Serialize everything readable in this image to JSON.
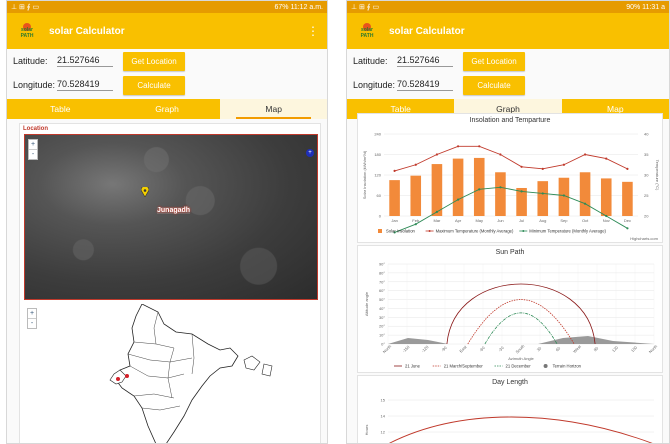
{
  "left_screen": {
    "status": {
      "left_icons": "⊥ ⊞ ∮ ▭",
      "right": "67% 11:12 a.m."
    },
    "app_title": "solar Calculator",
    "logo_text": "solar PATH",
    "menu_icon": "⋮",
    "latitude_label": "Latitude:",
    "latitude_value": "21.527646",
    "longitude_label": "Longitude:",
    "longitude_value": "70.528419",
    "get_location_label": "Get Location",
    "calculate_label": "Calculate",
    "tabs": [
      "Table",
      "Graph",
      "Map"
    ],
    "active_tab": "Map",
    "map_section_title": "Location",
    "place_label": "Junagadh",
    "zoom_in": "+",
    "zoom_out": "-"
  },
  "right_screen": {
    "status": {
      "left_icons": "⊥ ⊞ ∮ ▭",
      "right": "90% 11:31 a"
    },
    "app_title": "solar Calculator",
    "latitude_label": "Latitude:",
    "latitude_value": "21.527646",
    "longitude_label": "Longitude:",
    "longitude_value": "70.528419",
    "get_location_label": "Get Location",
    "calculate_label": "Calculate",
    "tabs": [
      "Table",
      "Graph",
      "Map"
    ],
    "active_tab": "Graph",
    "insolation_title": "Insolation and Temparture",
    "sun_path_title": "Sun Path",
    "day_length_title": "Day Length",
    "credit": "Highcharts.com"
  },
  "chart_data": [
    {
      "type": "bar",
      "title": "Insolation and Temparture",
      "categories": [
        "Jan",
        "Feb",
        "Mar",
        "Apr",
        "May",
        "Jun",
        "Jul",
        "Aug",
        "Sep",
        "Oct",
        "Nov",
        "Dec"
      ],
      "ylabel": "Solar Insolation (kWh/m²/d)",
      "ylabel_right": "Temperature (°C)",
      "ylim": [
        0,
        240
      ],
      "yticks": [
        0,
        60,
        120,
        180,
        240
      ],
      "y2ticks": [
        20,
        25,
        30,
        35,
        40
      ],
      "series": [
        {
          "name": "Solar Insolation",
          "kind": "bar",
          "color": "#f28a3a",
          "values": [
            105,
            118,
            152,
            168,
            170,
            128,
            82,
            102,
            112,
            128,
            110,
            100
          ]
        },
        {
          "name": "Maximum Temperature (Monthly Average)",
          "kind": "line",
          "color": "#c0392b",
          "values": [
            31,
            32.5,
            35,
            37,
            37,
            35,
            32,
            31.5,
            32.5,
            35,
            34,
            31.5
          ]
        },
        {
          "name": "Minimum Temperature (Monthly Average)",
          "kind": "line",
          "color": "#2e8b57",
          "values": [
            16,
            18,
            21,
            24,
            26.5,
            27,
            26,
            25.5,
            25,
            23,
            20,
            17
          ]
        }
      ]
    },
    {
      "type": "line",
      "title": "Sun Path",
      "xlabel": "Azimuth Angle",
      "ylabel": "Altitude angle",
      "x_tick_labels": [
        "North",
        "-150",
        "-120",
        "-90",
        "East",
        "-60",
        "-30",
        "South",
        "30",
        "60",
        "West",
        "90",
        "120",
        "150",
        "North"
      ],
      "y_tick_labels": [
        "0°",
        "10°",
        "20°",
        "30°",
        "40°",
        "50°",
        "60°",
        "70°",
        "80°",
        "90°"
      ],
      "ylim": [
        0,
        90
      ],
      "series": [
        {
          "name": "21 June",
          "color": "#8b1a1a"
        },
        {
          "name": "21 March/September",
          "color": "#c0392b"
        },
        {
          "name": "21 December",
          "color": "#2e8b57"
        },
        {
          "name": "Terrain Horizon",
          "color": "#777777"
        }
      ]
    },
    {
      "type": "line",
      "title": "Day Length",
      "ylabel": "Hours",
      "y_tick_labels": [
        "15",
        "14",
        "12"
      ]
    }
  ]
}
